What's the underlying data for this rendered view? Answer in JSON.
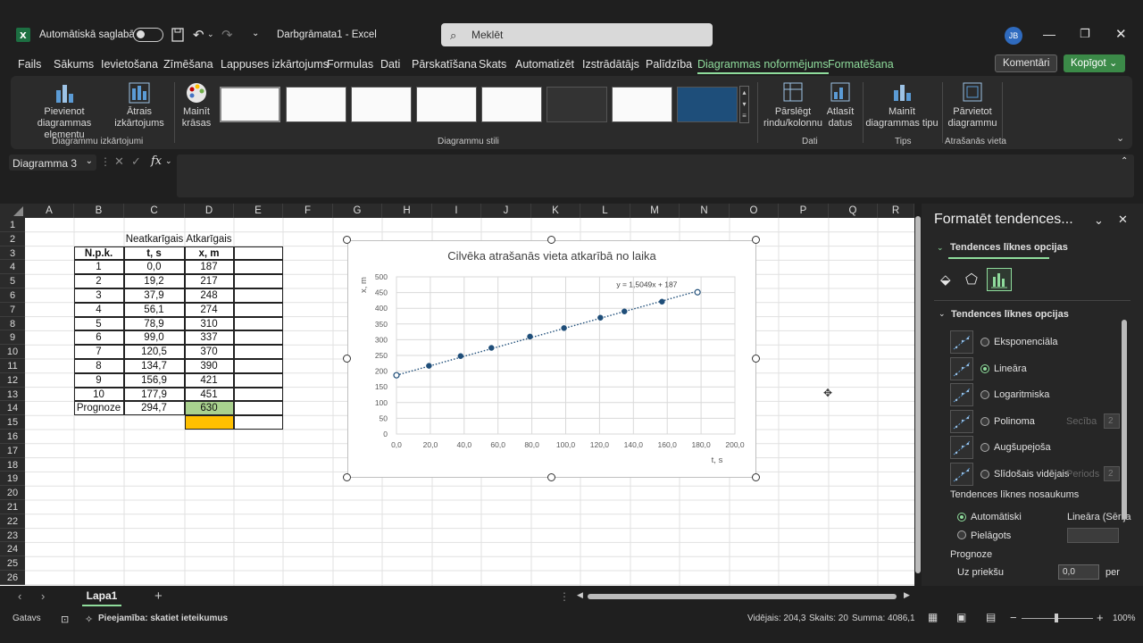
{
  "titlebar": {
    "autosave_label": "Automātiskā saglabāšana",
    "doc_title": "Darbgrāmata1  -  Excel",
    "search_placeholder": "Meklēt",
    "avatar": "JB"
  },
  "tabs": [
    "Fails",
    "Sākums",
    "Ievietošana",
    "Zīmēšana",
    "Lappuses izkārtojums",
    "Formulas",
    "Dati",
    "Pārskatīšana",
    "Skats",
    "Automatizēt",
    "Izstrādātājs",
    "Palīdzība",
    "Diagrammas noformējums",
    "Formatēšana"
  ],
  "header_buttons": {
    "comments": "Komentāri",
    "share": "Kopīgot"
  },
  "ribbon": {
    "add_element": "Pievienot diagrammas\nelementu",
    "quick_layout": "Ātrais\nizkārtojums",
    "change_colors": "Mainīt\nkrāsas",
    "switch_rowcol": "Pārslēgt\nrindu/kolonnu",
    "select_data": "Atlasīt\ndatus",
    "change_type": "Mainīt\ndiagrammas tipu",
    "move_chart": "Pārvietot\ndiagrammu",
    "groups": {
      "layouts": "Diagrammu izkārtojumi",
      "styles": "Diagrammu stili",
      "data": "Dati",
      "type": "Tips",
      "location": "Atrašanās vieta"
    }
  },
  "formula_bar": {
    "name_box": "Diagramma 3",
    "fx": "fx"
  },
  "columns": [
    "A",
    "B",
    "C",
    "D",
    "E",
    "F",
    "G",
    "H",
    "I",
    "J",
    "K",
    "L",
    "M",
    "N",
    "O",
    "P",
    "Q",
    "R"
  ],
  "rows": [
    "1",
    "2",
    "3",
    "4",
    "5",
    "6",
    "7",
    "8",
    "9",
    "10",
    "11",
    "12",
    "13",
    "14",
    "15",
    "16",
    "17",
    "18",
    "19",
    "20",
    "21",
    "22",
    "23",
    "24",
    "25",
    "26"
  ],
  "table": {
    "top_c": "Neatkarīgais",
    "top_d": "Atkarīgais",
    "headers": [
      "N.p.k.",
      "t, s",
      "x, m"
    ],
    "rows": [
      [
        "1",
        "0,0",
        "187"
      ],
      [
        "2",
        "19,2",
        "217"
      ],
      [
        "3",
        "37,9",
        "248"
      ],
      [
        "4",
        "56,1",
        "274"
      ],
      [
        "5",
        "78,9",
        "310"
      ],
      [
        "6",
        "99,0",
        "337"
      ],
      [
        "7",
        "120,5",
        "370"
      ],
      [
        "8",
        "134,7",
        "390"
      ],
      [
        "9",
        "156,9",
        "421"
      ],
      [
        "10",
        "177,9",
        "451"
      ]
    ],
    "forecast": [
      "Prognoze",
      "294,7",
      "630"
    ],
    "forecast_color": "#a9d18e",
    "highlight_color": "#ffc000"
  },
  "chart_data": {
    "type": "scatter",
    "title": "Cilvēka atrašanās vieta atkarībā no laika",
    "xlabel": "t, s",
    "ylabel": "x, m",
    "x": [
      0.0,
      19.2,
      37.9,
      56.1,
      78.9,
      99.0,
      120.5,
      134.7,
      156.9,
      177.9
    ],
    "y": [
      187,
      217,
      248,
      274,
      310,
      337,
      370,
      390,
      421,
      451
    ],
    "xlim": [
      0,
      200
    ],
    "ylim": [
      0,
      500
    ],
    "xticks": [
      "0,0",
      "20,0",
      "40,0",
      "60,0",
      "80,0",
      "100,0",
      "120,0",
      "140,0",
      "160,0",
      "180,0",
      "200,0"
    ],
    "yticks": [
      "0",
      "50",
      "100",
      "150",
      "200",
      "250",
      "300",
      "350",
      "400",
      "450",
      "500"
    ],
    "trendline": {
      "type": "linear",
      "slope": 1.5049,
      "intercept": 187,
      "label": "y = 1,5049x + 187"
    },
    "grid": true,
    "marker_color": "#1f4e79"
  },
  "pane": {
    "title": "Formatēt tendences...",
    "tab": "Tendences līknes opcijas",
    "section": "Tendences līknes opcijas",
    "options": [
      {
        "label": "Eksponenciāla",
        "selected": false
      },
      {
        "label": "Lineāra",
        "selected": true
      },
      {
        "label": "Logaritmiska",
        "selected": false
      },
      {
        "label": "Polinoma",
        "selected": false,
        "extra": "Secība",
        "extra_val": "2"
      },
      {
        "label": "Augšupejoša",
        "selected": false
      },
      {
        "label": "Slīdošais vidējais",
        "selected": false,
        "extra": "Periods",
        "extra_val": "2"
      }
    ],
    "name_heading": "Tendences līknes nosaukums",
    "auto_label": "Automātiski",
    "auto_value": "Lineāra (Sērija",
    "custom_label": "Pielāgots",
    "forecast_heading": "Prognoze",
    "forward_label": "Uz priekšu",
    "forward_value": "0,0",
    "forward_unit": "per"
  },
  "sheet": {
    "name": "Lapa1"
  },
  "status": {
    "mode": "Gatavs",
    "accessibility": "Pieejamība: skatiet ieteikumus",
    "average": "Vidējais: 204,3",
    "count": "Skaits: 20",
    "sum": "Summa: 4086,1",
    "zoom": "100%"
  }
}
